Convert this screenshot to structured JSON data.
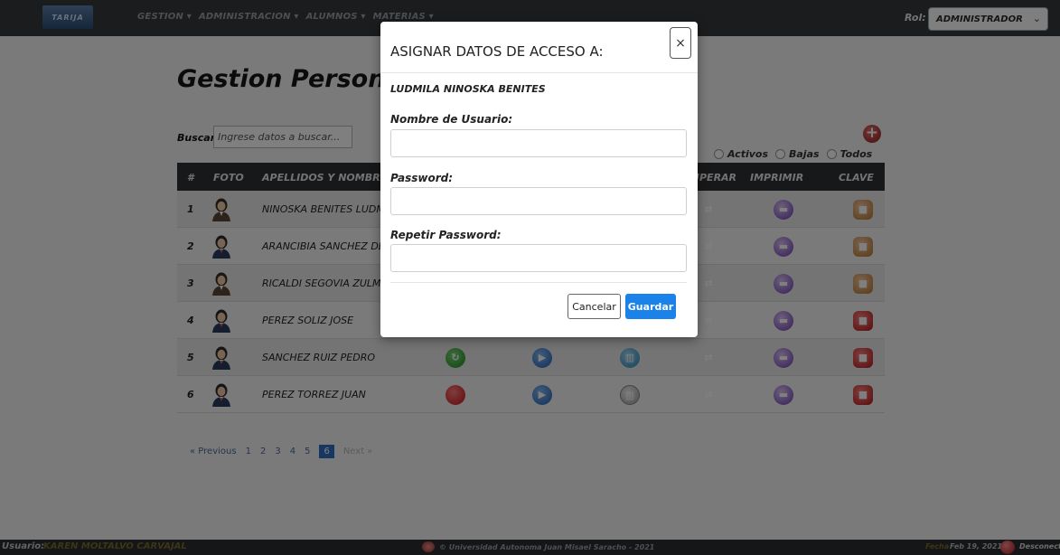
{
  "navbar": {
    "logo_text": "",
    "menu": [
      {
        "label": "GESTION ▾"
      },
      {
        "label": "ADMINISTRACION ▾"
      },
      {
        "label": "ALUMNOS ▾"
      },
      {
        "label": "MATERIAS ▾"
      }
    ],
    "rol_label": "Rol:",
    "rol_value": "ADMINISTRADOR"
  },
  "page": {
    "title": "Gestion Personas",
    "search_label": "Buscar",
    "search_placeholder": "Ingrese datos a buscar...",
    "filters": [
      "Activos",
      "Bajas",
      "Todos"
    ]
  },
  "table": {
    "headers": {
      "num": "#",
      "foto": "FOTO",
      "nombres": "APELLIDOS Y NOMBRES",
      "recuperar": "RECUPERAR",
      "imprimir": "IMPRIMIR",
      "clave": "CLAVE"
    },
    "rows": [
      {
        "num": "1",
        "name": "NINOSKA BENITES LUDMILA",
        "gender": "female",
        "status": "green",
        "key": "ok"
      },
      {
        "num": "2",
        "name": "ARANCIBIA SANCHEZ DENISSE",
        "gender": "male",
        "status": "green",
        "key": "ok"
      },
      {
        "num": "3",
        "name": "RICALDI SEGOVIA ZULMA",
        "gender": "female",
        "status": "green",
        "key": "ok"
      },
      {
        "num": "4",
        "name": "PEREZ SOLIZ JOSE",
        "gender": "male",
        "status": "green",
        "key": "locked"
      },
      {
        "num": "5",
        "name": "SANCHEZ RUIZ PEDRO",
        "gender": "male",
        "status": "green",
        "key": "locked"
      },
      {
        "num": "6",
        "name": "PEREZ TORREZ JUAN",
        "gender": "male",
        "status": "red",
        "key": "locked"
      }
    ]
  },
  "pagination": {
    "previous": "« Previous",
    "pages": [
      "1",
      "2",
      "3",
      "4",
      "5",
      "6"
    ],
    "active_page": "6",
    "next": "Next »"
  },
  "footer": {
    "user_label": "Usuario:",
    "user_name": "KAREN MOLTALVO CARVAJAL",
    "copyright": "© Universidad Autonoma Juan Misael Saracho - 2021",
    "date_label": "Fecha",
    "date_value": "Feb 19, 2021",
    "disconnect": "Desconectar"
  },
  "modal": {
    "title": "ASIGNAR DATOS DE ACCESO A:",
    "close_glyph": "×",
    "person_name": "LUDMILA NINOSKA BENITES",
    "username_label": "Nombre de Usuario:",
    "password_label": "Password:",
    "repeat_label": "Repetir Password:",
    "cancel_label": "Cancelar",
    "save_label": "Guardar"
  },
  "colors": {
    "navbar": "#35383d",
    "table_header": "#2f3033",
    "primary_button": "#1a82e8",
    "add_button": "#b22a2a"
  }
}
